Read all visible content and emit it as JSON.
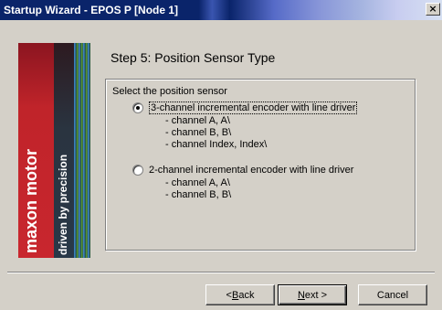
{
  "window": {
    "title": "Startup Wizard - EPOS P [Node 1]",
    "close_glyph": "×"
  },
  "banner": {
    "brand": "maxon motor",
    "slogan": "driven by precision",
    "colors": {
      "red": "#c8262e",
      "dark": "#1a2330"
    }
  },
  "step": {
    "title": "Step 5: Position Sensor Type"
  },
  "group": {
    "label": "Select the position sensor",
    "options": [
      {
        "label": "3-channel incremental encoder with line driver",
        "selected": true,
        "channels": [
          "- channel A, A\\",
          "- channel B, B\\",
          "- channel Index, Index\\"
        ]
      },
      {
        "label": "2-channel incremental encoder with line driver",
        "selected": false,
        "channels": [
          "- channel A, A\\",
          "- channel B, B\\"
        ]
      }
    ]
  },
  "buttons": {
    "back_prefix": "< ",
    "back_hotkey": "B",
    "back_rest": "ack",
    "next_hotkey": "N",
    "next_rest": "ext >",
    "cancel": "Cancel"
  }
}
